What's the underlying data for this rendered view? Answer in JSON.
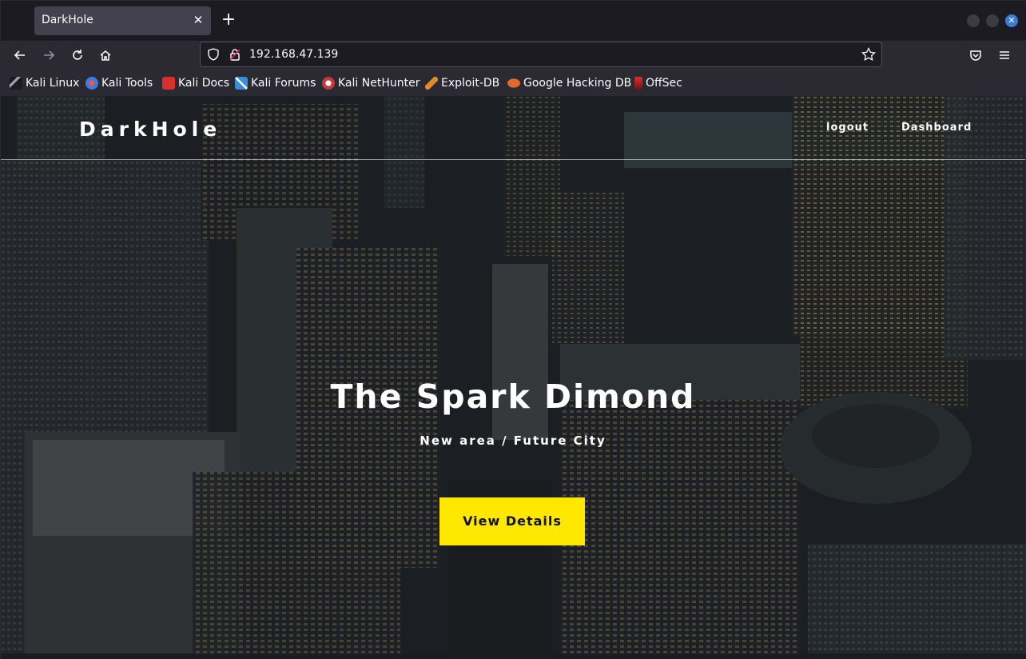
{
  "browser": {
    "tab_title": "DarkHole",
    "url": "192.168.47.139",
    "bookmarks": [
      {
        "label": "Kali Linux",
        "icon": "kali-dragon-icon",
        "color": "#9aa7b3"
      },
      {
        "label": "Kali Tools",
        "icon": "kali-tools-icon",
        "color": "#3e7be0"
      },
      {
        "label": "Kali Docs",
        "icon": "kali-docs-icon",
        "color": "#d9302c"
      },
      {
        "label": "Kali Forums",
        "icon": "kali-forums-icon",
        "color": "#3a8fd9"
      },
      {
        "label": "Kali NetHunter",
        "icon": "kali-nethunter-icon",
        "color": "#c73a3a"
      },
      {
        "label": "Exploit-DB",
        "icon": "exploit-db-icon",
        "color": "#e08a2a"
      },
      {
        "label": "Google Hacking DB",
        "icon": "ghdb-icon",
        "color": "#e06a2a"
      },
      {
        "label": "OffSec",
        "icon": "offsec-icon",
        "color": "#d9302c"
      }
    ]
  },
  "site": {
    "logo": "DarkHole",
    "nav": {
      "logout": "logout",
      "dashboard": "Dashboard"
    },
    "hero": {
      "title": "The Spark Dimond",
      "subtitle": "New area / Future City",
      "button": "View Details"
    },
    "accent_color": "#ffe800"
  }
}
